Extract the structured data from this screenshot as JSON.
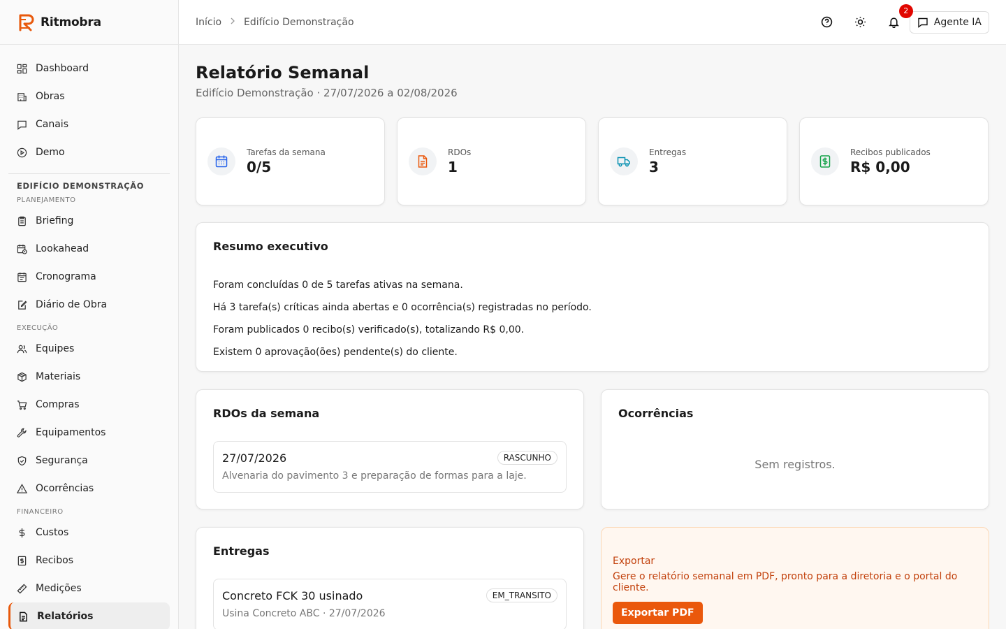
{
  "brand": {
    "name": "Ritmobra"
  },
  "nav": {
    "main": [
      {
        "label": "Dashboard",
        "icon": "dashboard-icon"
      },
      {
        "label": "Obras",
        "icon": "building-icon"
      },
      {
        "label": "Canais",
        "icon": "chat-icon"
      },
      {
        "label": "Demo",
        "icon": "play-icon"
      }
    ],
    "section_title": "EDIFÍCIO DEMONSTRAÇÃO",
    "groups": [
      {
        "title": "PLANEJAMENTO",
        "items": [
          {
            "label": "Briefing"
          },
          {
            "label": "Lookahead"
          },
          {
            "label": "Cronograma"
          },
          {
            "label": "Diário de Obra"
          }
        ]
      },
      {
        "title": "EXECUÇÃO",
        "items": [
          {
            "label": "Equipes"
          },
          {
            "label": "Materiais"
          },
          {
            "label": "Compras"
          },
          {
            "label": "Equipamentos"
          },
          {
            "label": "Segurança"
          },
          {
            "label": "Ocorrências"
          }
        ]
      },
      {
        "title": "FINANCEIRO",
        "items": [
          {
            "label": "Custos"
          },
          {
            "label": "Recibos"
          },
          {
            "label": "Medições"
          },
          {
            "label": "Relatórios",
            "active": true
          }
        ]
      }
    ]
  },
  "header": {
    "breadcrumb": [
      "Início",
      "Edifício Demonstração"
    ],
    "notifications_count": "2",
    "agent_label": "Agente IA"
  },
  "page": {
    "title": "Relatório Semanal",
    "subtitle": "Edifício Demonstração · 27/07/2026 a 02/08/2026"
  },
  "stats": [
    {
      "label": "Tarefas da semana",
      "value": "0/5",
      "icon": "calendar-icon",
      "color": "#2563eb"
    },
    {
      "label": "RDOs",
      "value": "1",
      "icon": "document-icon",
      "color": "#ea580c"
    },
    {
      "label": "Entregas",
      "value": "3",
      "icon": "truck-icon",
      "color": "#0891b2"
    },
    {
      "label": "Recibos publicados",
      "value": "R$ 0,00",
      "icon": "dollar-icon",
      "color": "#16a34a"
    }
  ],
  "summary": {
    "title": "Resumo executivo",
    "lines": [
      "Foram concluídas 0 de 5 tarefas ativas na semana.",
      "Há 3 tarefa(s) críticas ainda abertas e 0 ocorrência(s) registradas no período.",
      "Foram publicados 0 recibo(s) verificado(s), totalizando R$ 0,00.",
      "Existem 0 aprovação(ões) pendente(s) do cliente."
    ]
  },
  "rdos": {
    "title": "RDOs da semana",
    "items": [
      {
        "date": "27/07/2026",
        "status": "RASCUNHO",
        "description": "Alvenaria do pavimento 3 e preparação de formas para a laje."
      }
    ]
  },
  "ocorrencias": {
    "title": "Ocorrências",
    "empty": "Sem registros."
  },
  "entregas": {
    "title": "Entregas",
    "items": [
      {
        "name": "Concreto FCK 30 usinado",
        "status": "EM_TRANSITO",
        "meta": "Usina Concreto ABC · 27/07/2026"
      }
    ]
  },
  "export": {
    "title": "Exportar",
    "description": "Gere o relatório semanal em PDF, pronto para a diretoria e o portal do cliente.",
    "button": "Exportar PDF"
  }
}
